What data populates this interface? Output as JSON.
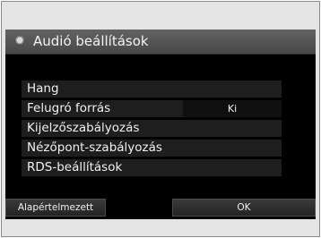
{
  "window": {
    "title": "Audió beállítások",
    "title_icon": "gear-icon"
  },
  "menu": {
    "items": [
      {
        "label": "Hang",
        "value": ""
      },
      {
        "label": "Felugró forrás",
        "value": "Ki"
      },
      {
        "label": "Kijelzőszabályozás",
        "value": ""
      },
      {
        "label": "Nézőpont-szabályozás",
        "value": ""
      },
      {
        "label": "RDS-beállítások",
        "value": ""
      }
    ]
  },
  "footer": {
    "default_label": "Alapértelmezett",
    "ok_label": "OK"
  },
  "colors": {
    "screen_background": "#000000",
    "title_bar": "#565656",
    "bezel": "#e4e4e4"
  }
}
